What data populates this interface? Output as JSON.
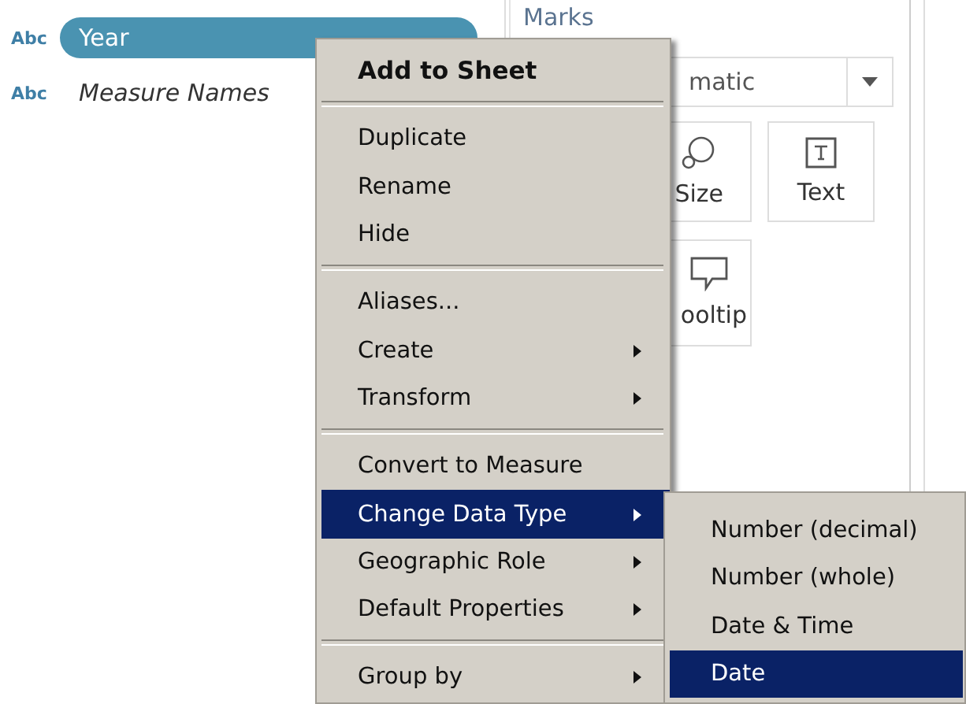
{
  "fields": [
    {
      "type_label": "Abc",
      "name": "Year",
      "selected": true
    },
    {
      "type_label": "Abc",
      "name": "Measure Names",
      "selected": false
    }
  ],
  "marks": {
    "title": "Marks",
    "mark_type": "matic",
    "cards": [
      {
        "kind": "size",
        "label": "Size"
      },
      {
        "kind": "text",
        "label": "Text"
      },
      {
        "kind": "tooltip",
        "label": "ooltip"
      }
    ]
  },
  "context_menu": {
    "groups": [
      [
        {
          "label": "Add to Sheet",
          "kind": "default",
          "submenu": false,
          "selected": false
        }
      ],
      [
        {
          "label": "Duplicate",
          "kind": "normal",
          "submenu": false,
          "selected": false
        },
        {
          "label": "Rename",
          "kind": "normal",
          "submenu": false,
          "selected": false
        },
        {
          "label": "Hide",
          "kind": "normal",
          "submenu": false,
          "selected": false
        }
      ],
      [
        {
          "label": "Aliases...",
          "kind": "normal",
          "submenu": false,
          "selected": false
        },
        {
          "label": "Create",
          "kind": "normal",
          "submenu": true,
          "selected": false
        },
        {
          "label": "Transform",
          "kind": "normal",
          "submenu": true,
          "selected": false
        }
      ],
      [
        {
          "label": "Convert to Measure",
          "kind": "normal",
          "submenu": false,
          "selected": false
        },
        {
          "label": "Change Data Type",
          "kind": "normal",
          "submenu": true,
          "selected": true
        },
        {
          "label": "Geographic Role",
          "kind": "normal",
          "submenu": true,
          "selected": false
        },
        {
          "label": "Default Properties",
          "kind": "normal",
          "submenu": true,
          "selected": false
        }
      ],
      [
        {
          "label": "Group by",
          "kind": "normal",
          "submenu": true,
          "selected": false
        }
      ]
    ]
  },
  "submenu": {
    "items": [
      {
        "label": "Number (decimal)",
        "selected": false
      },
      {
        "label": "Number (whole)",
        "selected": false
      },
      {
        "label": "Date & Time",
        "selected": false
      },
      {
        "label": "Date",
        "selected": true
      }
    ]
  }
}
